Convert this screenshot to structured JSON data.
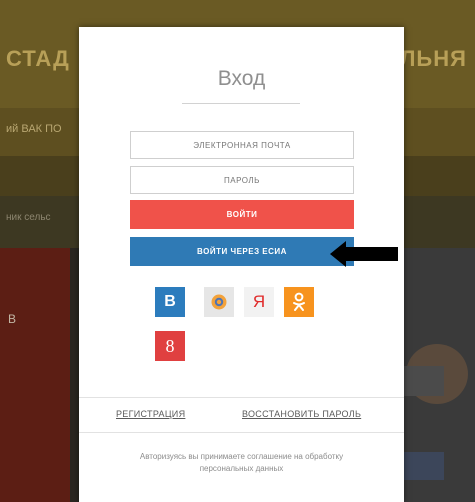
{
  "background": {
    "banner_left_text": "СТАД",
    "banner_right_text": "ЛЬНЯ",
    "band_text": "ий ВАК ПО",
    "band_text_2": "ник сельс",
    "card_left_text": "В"
  },
  "modal": {
    "title": "Вход",
    "email_placeholder": "ЭЛЕКТРОННАЯ ПОЧТА",
    "password_placeholder": "ПАРОЛЬ",
    "login_button": "ВОЙТИ",
    "esia_button": "ВОЙТИ ЧЕРЕЗ ЕСИА",
    "social": {
      "vk": "B",
      "yandex": "Я",
      "google": "8"
    },
    "register_link": "РЕГИСТРАЦИЯ",
    "restore_link": "ВОССТАНОВИТЬ ПАРОЛЬ",
    "agreement": "Авторизуясь вы принимаете соглашение на обработку персональных данных"
  },
  "colors": {
    "login_button": "#f0524a",
    "esia_button": "#2f7ab5",
    "vk": "#2c7cbd",
    "ok": "#f7931e",
    "google": "#e04040"
  },
  "icons": [
    "arrow-pointer-icon",
    "vk-icon",
    "mailru-icon",
    "yandex-icon",
    "odnoklassniki-icon",
    "google-plus-icon"
  ]
}
